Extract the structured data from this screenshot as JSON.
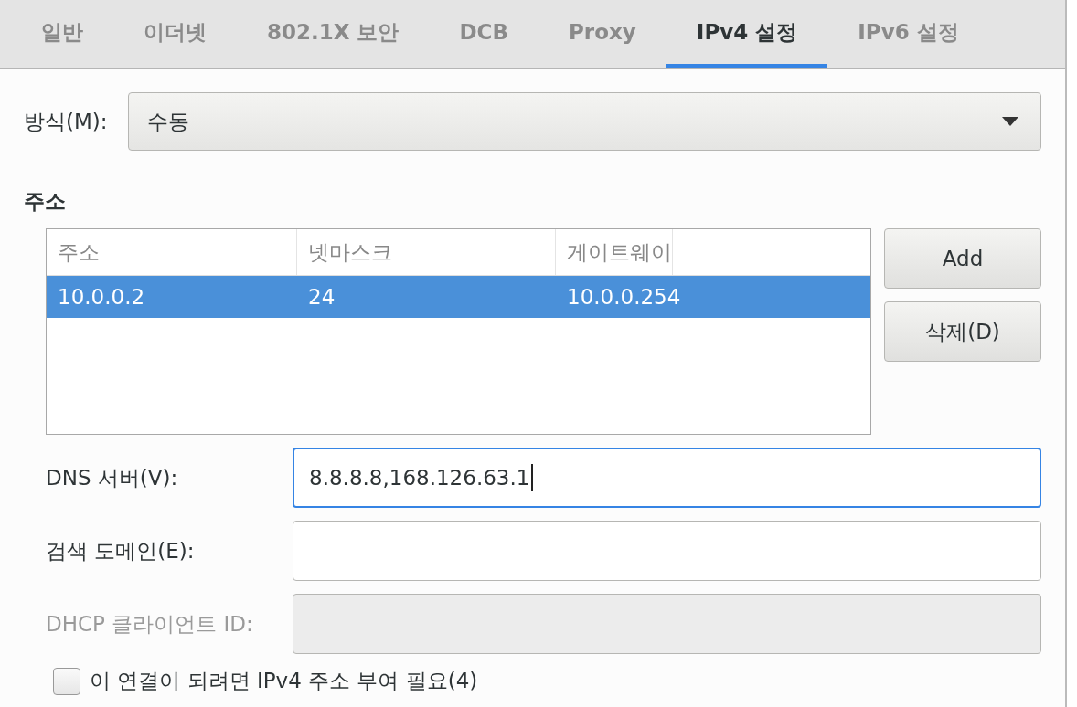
{
  "tabs": [
    {
      "label": "일반",
      "selected": false
    },
    {
      "label": "이더넷",
      "selected": false
    },
    {
      "label": "802.1X 보안",
      "selected": false
    },
    {
      "label": "DCB",
      "selected": false
    },
    {
      "label": "Proxy",
      "selected": false
    },
    {
      "label": "IPv4 설정",
      "selected": true
    },
    {
      "label": "IPv6 설정",
      "selected": false
    }
  ],
  "method": {
    "label": "방식(M):",
    "value": "수동"
  },
  "addresses": {
    "heading": "주소",
    "columns": [
      "주소",
      "넷마스크",
      "게이트웨이"
    ],
    "rows": [
      {
        "cells": [
          "10.0.0.2",
          "24",
          "10.0.0.254"
        ],
        "selected": true
      }
    ],
    "buttons": [
      "Add",
      "삭제(D)"
    ]
  },
  "fields": [
    {
      "label": "DNS 서버(V):",
      "value": "8.8.8.8,168.126.63.1",
      "focused": true,
      "disabled": false
    },
    {
      "label": "검색 도메인(E):",
      "focused": false,
      "disabled": false
    },
    {
      "label": "DHCP 클라이언트 ID:",
      "focused": false,
      "disabled": true
    }
  ],
  "require_ipv4": {
    "label": "이 연결이 되려면 IPv4 주소 부여 필요(4)",
    "checked": false
  }
}
